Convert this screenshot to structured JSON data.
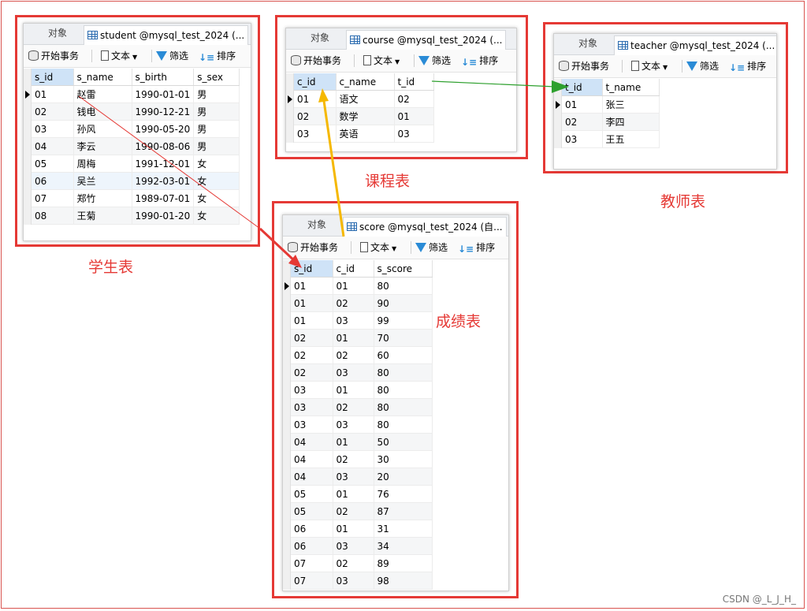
{
  "tabs": {
    "object_label": "对象"
  },
  "toolbar": {
    "begin": "开始事务",
    "text": "文本",
    "filter": "筛选",
    "sort": "排序"
  },
  "student": {
    "tab_title": "student @mysql_test_2024 (...",
    "caption": "学生表",
    "columns": [
      "s_id",
      "s_name",
      "s_birth",
      "s_sex"
    ],
    "rows": [
      [
        "01",
        "赵雷",
        "1990-01-01",
        "男"
      ],
      [
        "02",
        "钱电",
        "1990-12-21",
        "男"
      ],
      [
        "03",
        "孙风",
        "1990-05-20",
        "男"
      ],
      [
        "04",
        "李云",
        "1990-08-06",
        "男"
      ],
      [
        "05",
        "周梅",
        "1991-12-01",
        "女"
      ],
      [
        "06",
        "吴兰",
        "1992-03-01",
        "女"
      ],
      [
        "07",
        "郑竹",
        "1989-07-01",
        "女"
      ],
      [
        "08",
        "王菊",
        "1990-01-20",
        "女"
      ]
    ]
  },
  "course": {
    "tab_title": "course @mysql_test_2024 (...",
    "caption": "课程表",
    "columns": [
      "c_id",
      "c_name",
      "t_id"
    ],
    "rows": [
      [
        "01",
        "语文",
        "02"
      ],
      [
        "02",
        "数学",
        "01"
      ],
      [
        "03",
        "英语",
        "03"
      ]
    ]
  },
  "teacher": {
    "tab_title": "teacher @mysql_test_2024 (...",
    "caption": "教师表",
    "columns": [
      "t_id",
      "t_name"
    ],
    "rows": [
      [
        "01",
        "张三"
      ],
      [
        "02",
        "李四"
      ],
      [
        "03",
        "王五"
      ]
    ]
  },
  "score": {
    "tab_title": "score @mysql_test_2024 (自...",
    "caption": "成绩表",
    "columns": [
      "s_id",
      "c_id",
      "s_score"
    ],
    "rows": [
      [
        "01",
        "01",
        "80"
      ],
      [
        "01",
        "02",
        "90"
      ],
      [
        "01",
        "03",
        "99"
      ],
      [
        "02",
        "01",
        "70"
      ],
      [
        "02",
        "02",
        "60"
      ],
      [
        "02",
        "03",
        "80"
      ],
      [
        "03",
        "01",
        "80"
      ],
      [
        "03",
        "02",
        "80"
      ],
      [
        "03",
        "03",
        "80"
      ],
      [
        "04",
        "01",
        "50"
      ],
      [
        "04",
        "02",
        "30"
      ],
      [
        "04",
        "03",
        "20"
      ],
      [
        "05",
        "01",
        "76"
      ],
      [
        "05",
        "02",
        "87"
      ],
      [
        "06",
        "01",
        "31"
      ],
      [
        "06",
        "03",
        "34"
      ],
      [
        "07",
        "02",
        "89"
      ],
      [
        "07",
        "03",
        "98"
      ]
    ]
  },
  "watermark": "CSDN @_L_J_H_",
  "colors": {
    "frame": "#e53935",
    "arrow_student_score": "#e53935",
    "arrow_course_score": "#f5b800",
    "arrow_course_teacher": "#2ea02e"
  }
}
